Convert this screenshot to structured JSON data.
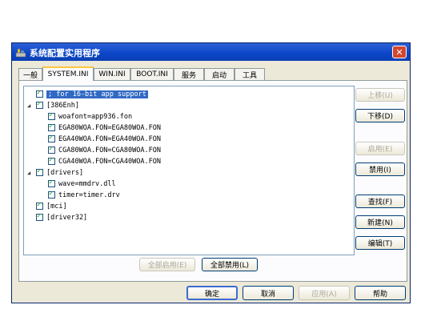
{
  "window": {
    "title": "系统配置实用程序",
    "close_glyph": "✕"
  },
  "tabs": [
    "一般",
    "SYSTEM.INI",
    "WIN.INI",
    "BOOT.INI",
    "服务",
    "启动",
    "工具"
  ],
  "active_tab": "SYSTEM.INI",
  "tree": [
    {
      "text": "; for 16-bit app support",
      "selected": true
    },
    {
      "text": "[386Enh]",
      "expander": "◢"
    },
    {
      "text": "woafont=app936.fon"
    },
    {
      "text": "EGA80WOA.FON=EGA80WOA.FON"
    },
    {
      "text": "EGA40WOA.FON=EGA40WOA.FON"
    },
    {
      "text": "CGA80WOA.FON=CGA80WOA.FON"
    },
    {
      "text": "CGA40WOA.FON=CGA40WOA.FON"
    },
    {
      "text": "[drivers]",
      "expander": "◢"
    },
    {
      "text": "wave=mmdrv.dll"
    },
    {
      "text": "timer=timer.drv"
    },
    {
      "text": "[mci]"
    },
    {
      "text": "[driver32]"
    }
  ],
  "side_buttons": {
    "move_up": "上移(U)",
    "move_down": "下移(D)",
    "enable": "启用(E)",
    "disable": "禁用(I)",
    "find": "查找(F)",
    "new": "新建(N)",
    "edit": "编辑(T)"
  },
  "panel_buttons": {
    "enable_all": "全部启用(E)",
    "disable_all": "全部禁用(L)"
  },
  "dialog_buttons": {
    "ok": "确定",
    "cancel": "取消",
    "apply": "应用(A)",
    "help": "帮助"
  }
}
